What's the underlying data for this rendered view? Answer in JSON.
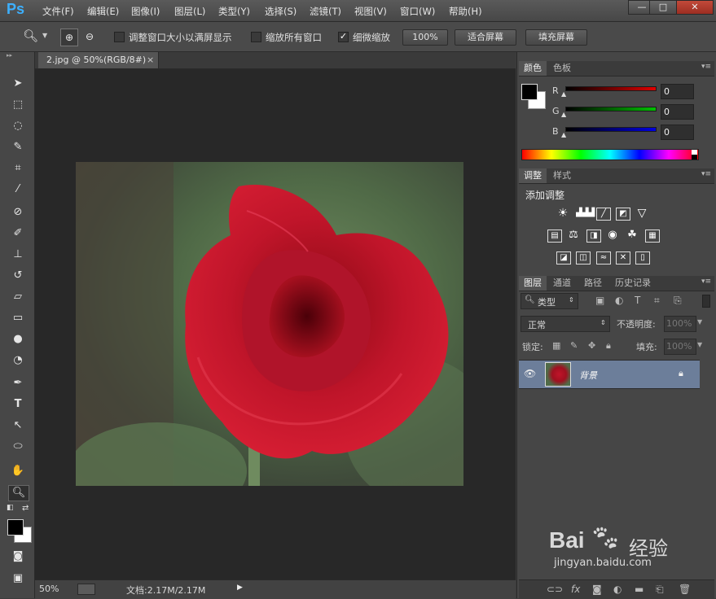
{
  "app": {
    "logo": "Ps"
  },
  "menu": [
    "文件(F)",
    "编辑(E)",
    "图像(I)",
    "图层(L)",
    "类型(Y)",
    "选择(S)",
    "滤镜(T)",
    "视图(V)",
    "窗口(W)",
    "帮助(H)"
  ],
  "window_controls": {
    "minimize": "—",
    "maximize": "□",
    "close": "✕"
  },
  "options": {
    "resize_windows_label": "调整窗口大小以满屏显示",
    "resize_windows_checked": false,
    "zoom_all_label": "缩放所有窗口",
    "zoom_all_checked": false,
    "scrubby_label": "细微缩放",
    "scrubby_checked": true,
    "btn_100": "100%",
    "btn_fit": "适合屏幕",
    "btn_fill": "填充屏幕"
  },
  "document": {
    "tab_title": "2.jpg @ 50%(RGB/8#)",
    "tab_close": "×",
    "zoom": "50%",
    "doc_info": "文档:2.17M/2.17M"
  },
  "color_panel": {
    "tabs": [
      "颜色",
      "色板"
    ],
    "channels": [
      {
        "label": "R",
        "value": "0",
        "color": "#e00000"
      },
      {
        "label": "G",
        "value": "0",
        "color": "#00c000"
      },
      {
        "label": "B",
        "value": "0",
        "color": "#0000e0"
      }
    ]
  },
  "adjust_panel": {
    "tabs": [
      "调整",
      "样式"
    ],
    "title": "添加调整"
  },
  "layers_panel": {
    "tabs": [
      "图层",
      "通道",
      "路径",
      "历史记录"
    ],
    "filter_kind": "类型",
    "blend_mode": "正常",
    "opacity_label": "不透明度:",
    "opacity_value": "100%",
    "lock_label": "锁定:",
    "fill_label": "填充:",
    "fill_value": "100%",
    "layers": [
      {
        "name": "背景",
        "visible": true,
        "locked": true
      }
    ]
  },
  "watermark": {
    "brand": "Bai",
    "brand2": "经验",
    "url": "jingyan.baidu.com"
  }
}
